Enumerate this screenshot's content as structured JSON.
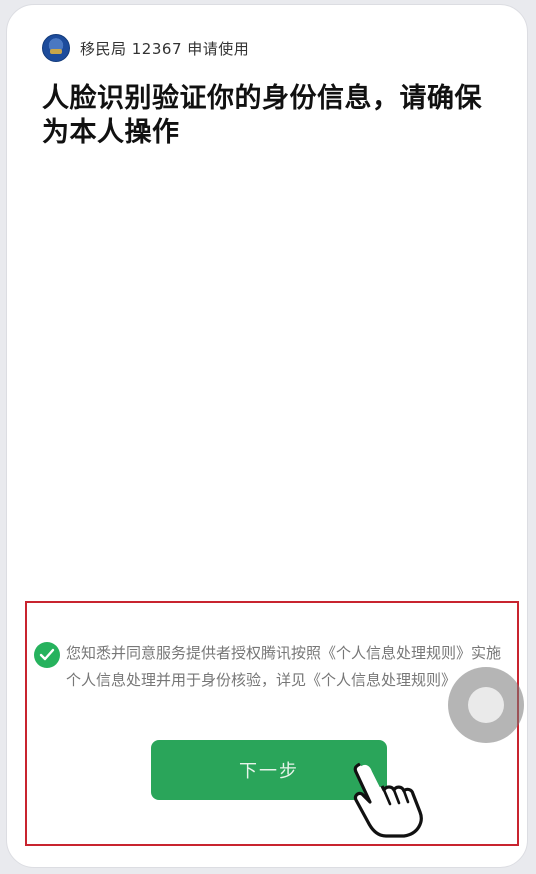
{
  "app": {
    "name": "移民局 12367 申请使用",
    "logo_icon": "immigration-emblem-icon"
  },
  "title": "人脸识别验证你的身份信息，请确保为本人操作",
  "consent": {
    "checked": true,
    "text": "您知悉并同意服务提供者授权腾讯按照《个人信息处理规则》实施个人信息处理并用于身份核验，详见《个人信息处理规则》"
  },
  "buttons": {
    "next_label": "下一步"
  },
  "colors": {
    "primary_green": "#2aa55a",
    "highlight_red": "#c8242f"
  }
}
